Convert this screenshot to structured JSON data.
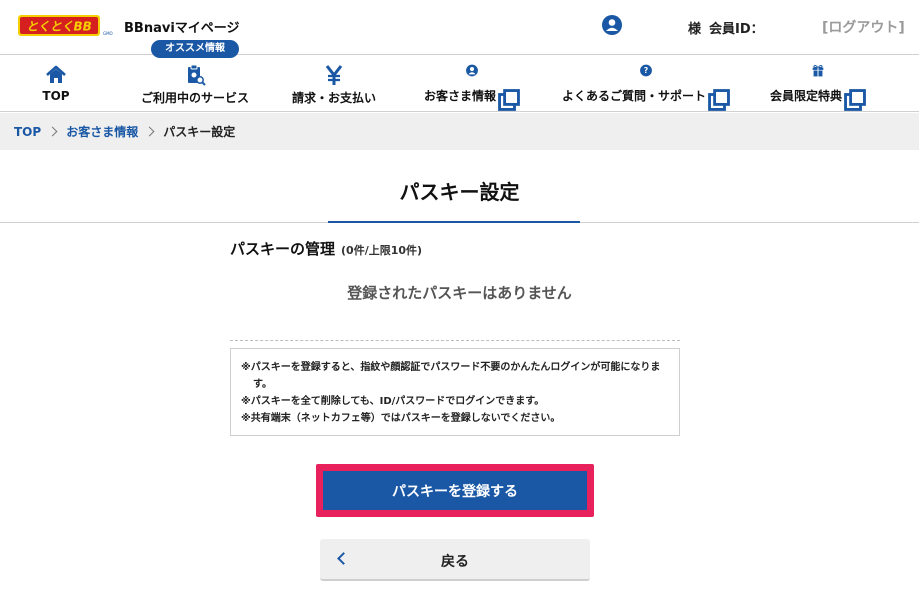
{
  "header": {
    "logo_text": "とくとくBB",
    "site_name": "BBnaviマイページ",
    "member_suffix": "様",
    "member_id_label": "会員ID：",
    "logout": "[ログアウト]"
  },
  "nav": {
    "badge": "オススメ情報",
    "items": [
      {
        "label": "TOP",
        "icon": "home-icon"
      },
      {
        "label": "ご利用中のサービス",
        "icon": "service-icon"
      },
      {
        "label": "請求・お支払い",
        "icon": "yen-icon"
      },
      {
        "label": "お客さま情報",
        "icon": "user-icon",
        "external": true
      },
      {
        "label": "よくあるご質問・サポート",
        "icon": "question-icon",
        "external": true
      },
      {
        "label": "会員限定特典",
        "icon": "gift-icon",
        "external": true
      }
    ]
  },
  "breadcrumb": {
    "items": [
      "TOP",
      "お客さま情報"
    ],
    "current": "パスキー設定"
  },
  "page": {
    "title": "パスキー設定",
    "section_title": "パスキーの管理",
    "section_count": "(0件/上限10件)",
    "empty_message": "登録されたパスキーはありません",
    "notes": [
      "※パスキーを登録すると、指紋や顔認証でパスワード不要のかんたんログインが可能になります。",
      "※パスキーを全て削除しても、ID/パスワードでログインできます。",
      "※共有端末（ネットカフェ等）ではパスキーを登録しないでください。"
    ],
    "register_button": "パスキーを登録する",
    "back_button": "戻る"
  },
  "colors": {
    "brand_blue": "#1a58a5",
    "highlight_frame": "#e8205c",
    "logo_yellow": "#f5d000",
    "logo_red": "#d6201f"
  }
}
